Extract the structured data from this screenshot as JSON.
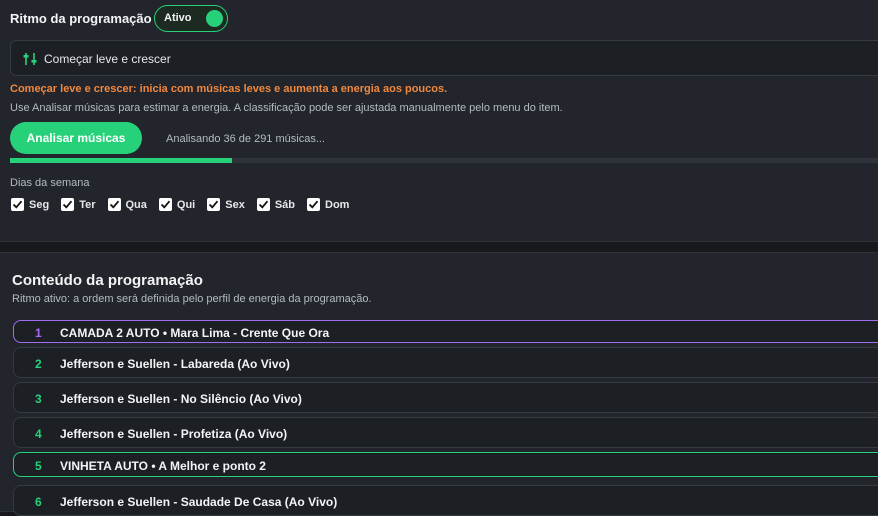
{
  "rhythm": {
    "title": "Ritmo da programação",
    "toggle_label": "Ativo",
    "select_value": "Começar leve e crescer",
    "select_icon": "sliders-icon",
    "warning": "Começar leve e crescer: inicia com músicas leves e aumenta a energia aos poucos.",
    "help": "Use Analisar músicas para estimar a energia. A classificação pode ser ajustada manualmente pelo menu do item.",
    "analyze_label": "Analisar músicas",
    "progress_text": "Analisando 36 de 291 músicas...",
    "progress_done": 36,
    "progress_total": 291,
    "days_label": "Dias da semana",
    "days": [
      {
        "label": "Seg",
        "checked": true
      },
      {
        "label": "Ter",
        "checked": true
      },
      {
        "label": "Qua",
        "checked": true
      },
      {
        "label": "Qui",
        "checked": true
      },
      {
        "label": "Sex",
        "checked": true
      },
      {
        "label": "Sáb",
        "checked": true
      },
      {
        "label": "Dom",
        "checked": true
      }
    ]
  },
  "content": {
    "title": "Conteúdo da programação",
    "subtitle": "Ritmo ativo: a ordem será definida pelo perfil de energia da programação.",
    "items": [
      {
        "num": "1",
        "title": "CAMADA 2 AUTO • Mara Lima - Crente Que Ora",
        "kind": "layer"
      },
      {
        "num": "2",
        "title": "Jefferson e Suellen - Labareda (Ao Vivo)",
        "kind": "song"
      },
      {
        "num": "3",
        "title": "Jefferson e Suellen - No Silêncio (Ao Vivo)",
        "kind": "song"
      },
      {
        "num": "4",
        "title": "Jefferson e Suellen - Profetiza (Ao Vivo)",
        "kind": "song"
      },
      {
        "num": "5",
        "title": "VINHETA AUTO • A Melhor e ponto 2",
        "kind": "vinheta"
      },
      {
        "num": "6",
        "title": "Jefferson e Suellen - Saudade De Casa (Ao Vivo)",
        "kind": "song"
      }
    ]
  },
  "colors": {
    "accent": "#27d17a",
    "warning": "#f0883e",
    "layer": "#a36cf0"
  }
}
